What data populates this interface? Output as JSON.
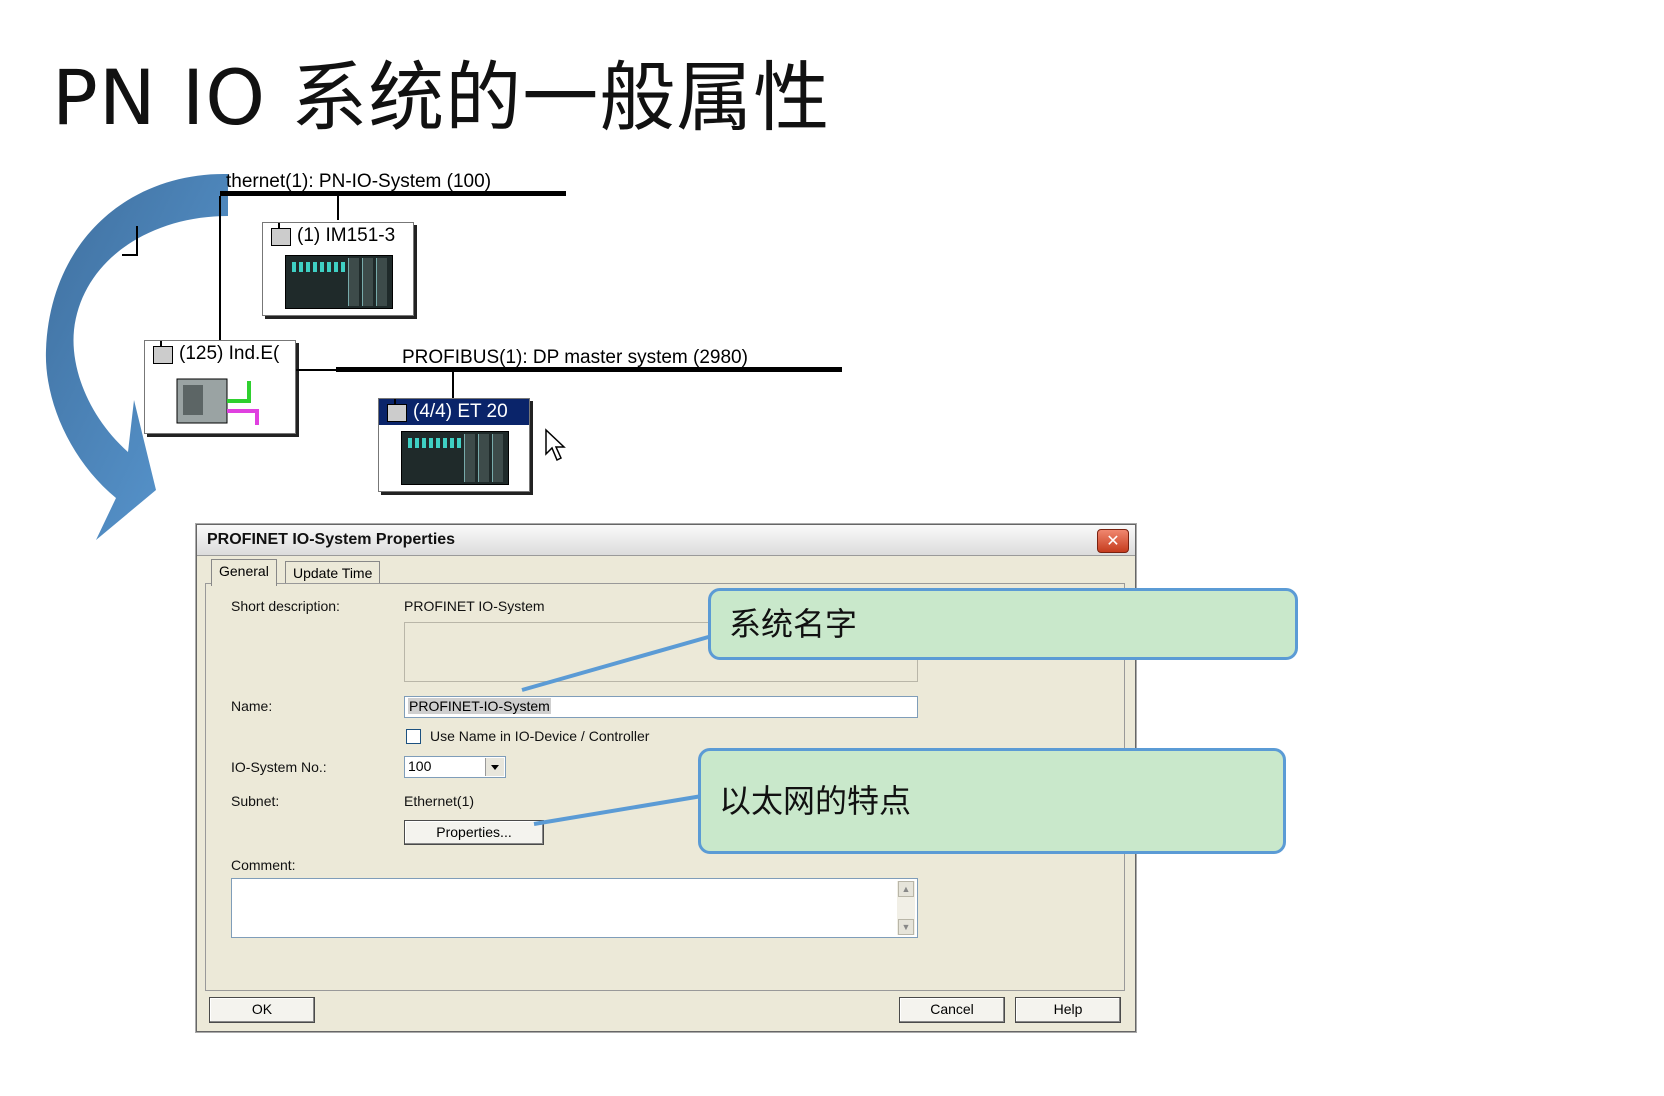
{
  "slide": {
    "title": "PN IO 系统的一般属性"
  },
  "network": {
    "ethernet_label": "thernet(1): PN-IO-System (100)",
    "profibus_label": "PROFIBUS(1): DP master system (2980)",
    "stations": [
      {
        "label": "(1) IM151-3"
      },
      {
        "label": "(125) Ind.E("
      },
      {
        "label": "(4/4) ET 20"
      }
    ]
  },
  "dialog": {
    "title": "PROFINET IO-System Properties",
    "tabs": [
      "General",
      "Update Time"
    ],
    "short_description_label": "Short description:",
    "short_description_value": "PROFINET IO-System",
    "name_label": "Name:",
    "name_value": "PROFINET-IO-System",
    "use_name_label": "Use Name in IO-Device / Controller",
    "io_system_no_label": "IO-System No.:",
    "io_system_no_value": "100",
    "subnet_label": "Subnet:",
    "subnet_value": "Ethernet(1)",
    "properties_button": "Properties...",
    "comment_label": "Comment:",
    "ok_button": "OK",
    "cancel_button": "Cancel",
    "help_button": "Help"
  },
  "callouts": {
    "system_name": "系统名字",
    "ethernet_features": "以太网的特点"
  },
  "colors": {
    "arrow": "#5b9bd5",
    "callout_fill": "#c9e8cb",
    "callout_border": "#5b9bd5",
    "selection": "#0a246a"
  }
}
